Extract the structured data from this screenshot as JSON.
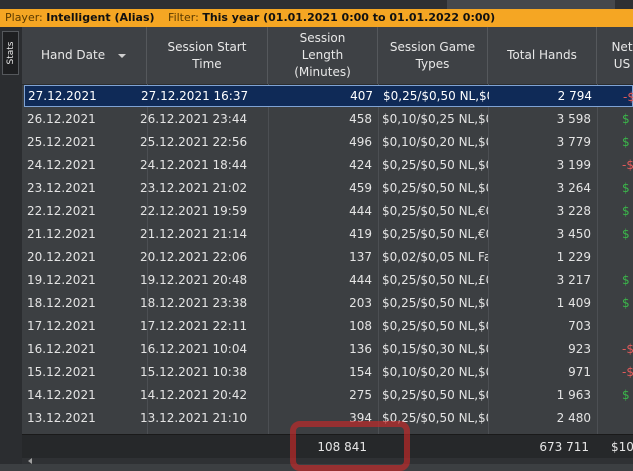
{
  "filter_bar": {
    "player_label": "Player:",
    "player_value": "Intelligent (Alias)",
    "filter_label": "Filter:",
    "filter_value": "This year (01.01.2021 0:00 to 01.01.2022 0:00)"
  },
  "side_tab": {
    "label": "Stats"
  },
  "columns": [
    {
      "label": "Hand Date",
      "sorted": "descending"
    },
    {
      "label": "Session Start\nTime"
    },
    {
      "label": "Session\nLength\n(Minutes)"
    },
    {
      "label": "Session Game\nTypes"
    },
    {
      "label": "Total Hands"
    },
    {
      "label": "Net\nUS"
    }
  ],
  "rows": [
    {
      "date": "27.12.2021",
      "start": "27.12.2021 16:37",
      "length": "407",
      "types": "$0,25/$0,50 NL,$0",
      "hands": "2 794",
      "net": "-$",
      "net_color": "#e05a5a",
      "selected": true
    },
    {
      "date": "26.12.2021",
      "start": "26.12.2021 23:44",
      "length": "458",
      "types": "$0,10/$0,25 NL,$0",
      "hands": "3 598",
      "net": "$",
      "net_color": "#3bb54a"
    },
    {
      "date": "25.12.2021",
      "start": "25.12.2021 22:56",
      "length": "496",
      "types": "$0,10/$0,20 NL,$0",
      "hands": "3 779",
      "net": "$",
      "net_color": "#3bb54a"
    },
    {
      "date": "24.12.2021",
      "start": "24.12.2021 18:44",
      "length": "424",
      "types": "$0,25/$0,50 NL,$0",
      "hands": "3 199",
      "net": "-$",
      "net_color": "#e05a5a"
    },
    {
      "date": "23.12.2021",
      "start": "23.12.2021 21:02",
      "length": "459",
      "types": "$0,25/$0,50 NL,$0",
      "hands": "3 264",
      "net": "$",
      "net_color": "#3bb54a"
    },
    {
      "date": "22.12.2021",
      "start": "22.12.2021 19:59",
      "length": "444",
      "types": "$0,25/$0,50 NL,€0",
      "hands": "3 228",
      "net": "$",
      "net_color": "#3bb54a"
    },
    {
      "date": "21.12.2021",
      "start": "21.12.2021 21:14",
      "length": "419",
      "types": "$0,25/$0,50 NL,€0",
      "hands": "3 450",
      "net": "$",
      "net_color": "#3bb54a"
    },
    {
      "date": "20.12.2021",
      "start": "20.12.2021 22:06",
      "length": "137",
      "types": "$0,02/$0,05 NL Fa:",
      "hands": "1 229",
      "net": "",
      "net_color": ""
    },
    {
      "date": "19.12.2021",
      "start": "19.12.2021 20:48",
      "length": "444",
      "types": "$0,25/$0,50 NL,£0",
      "hands": "3 217",
      "net": "$",
      "net_color": "#3bb54a"
    },
    {
      "date": "18.12.2021",
      "start": "18.12.2021 23:38",
      "length": "203",
      "types": "$0,25/$0,50 NL,$0",
      "hands": "1 409",
      "net": "$",
      "net_color": "#3bb54a"
    },
    {
      "date": "17.12.2021",
      "start": "17.12.2021 22:11",
      "length": "108",
      "types": "$0,25/$0,50 NL,$0",
      "hands": "703",
      "net": "",
      "net_color": ""
    },
    {
      "date": "16.12.2021",
      "start": "16.12.2021 10:04",
      "length": "136",
      "types": "$0,15/$0,30 NL,$0",
      "hands": "923",
      "net": "-$",
      "net_color": "#e05a5a"
    },
    {
      "date": "15.12.2021",
      "start": "15.12.2021 10:38",
      "length": "154",
      "types": "$0,10/$0,20 NL,$0",
      "hands": "971",
      "net": "-$",
      "net_color": "#e05a5a"
    },
    {
      "date": "14.12.2021",
      "start": "14.12.2021 20:42",
      "length": "275",
      "types": "$0,25/$0,50 NL,$0",
      "hands": "1 963",
      "net": "$",
      "net_color": "#3bb54a"
    },
    {
      "date": "13.12.2021",
      "start": "13.12.2021 21:10",
      "length": "394",
      "types": "$0,25/$0,50 NL,$0",
      "hands": "2 480",
      "net": "",
      "net_color": ""
    }
  ],
  "totals": {
    "length": "108 841",
    "hands": "673 711",
    "net": "$10"
  },
  "colors": {
    "filter_bar": "#f5a623",
    "selected_row": "#0f2a57",
    "highlight": "#c82828"
  }
}
